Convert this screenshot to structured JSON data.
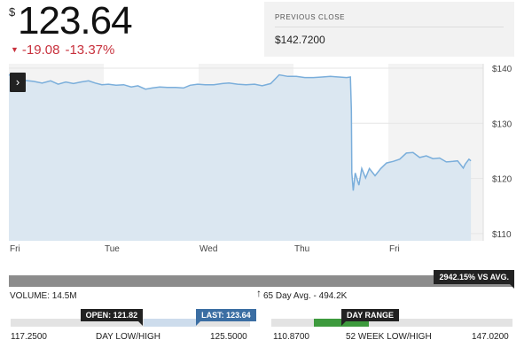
{
  "quote": {
    "currency_symbol": "$",
    "price": "123.64",
    "change": "-19.08",
    "change_percent": "-13.37%",
    "change_color": "#c8313d"
  },
  "previous_close": {
    "label": "PREVIOUS CLOSE",
    "value": "$142.7200"
  },
  "chart_toggle_label": "›",
  "chart_data": {
    "type": "area",
    "x_tick_labels": [
      "Fri",
      "Tue",
      "Wed",
      "Thu",
      "Fri"
    ],
    "y_tick_labels": [
      "$140",
      "$130",
      "$120",
      "$110"
    ],
    "y_ticks": [
      140,
      130,
      120,
      110
    ],
    "ylim": [
      108.7,
      140.8
    ],
    "grid": true,
    "line_color": "#7aaedb",
    "fill_color": "#dbe7f1",
    "series": [
      {
        "points": [
          [
            0,
            138.8
          ],
          [
            0.3,
            138.6
          ],
          [
            1.0,
            138.0
          ],
          [
            1.6,
            137.8
          ],
          [
            2.6,
            137.6
          ],
          [
            3.5,
            137.3
          ],
          [
            4.4,
            137.7
          ],
          [
            5.2,
            137.1
          ],
          [
            6.0,
            137.5
          ],
          [
            6.8,
            137.2
          ],
          [
            7.6,
            137.5
          ],
          [
            8.4,
            137.7
          ],
          [
            9.1,
            137.3
          ],
          [
            9.8,
            137.0
          ],
          [
            10.5,
            137.1
          ],
          [
            11.3,
            136.9
          ],
          [
            12.1,
            137.0
          ],
          [
            12.9,
            136.6
          ],
          [
            13.6,
            136.8
          ],
          [
            14.4,
            136.2
          ],
          [
            15.1,
            136.4
          ],
          [
            15.9,
            136.6
          ],
          [
            16.7,
            136.5
          ],
          [
            17.6,
            136.5
          ],
          [
            18.4,
            136.4
          ],
          [
            19.1,
            136.9
          ],
          [
            19.9,
            137.1
          ],
          [
            20.7,
            137.0
          ],
          [
            21.6,
            137.0
          ],
          [
            22.5,
            137.2
          ],
          [
            23.2,
            137.3
          ],
          [
            24.1,
            137.1
          ],
          [
            25.0,
            137.0
          ],
          [
            25.9,
            137.1
          ],
          [
            26.7,
            136.8
          ],
          [
            27.6,
            137.2
          ],
          [
            28.5,
            138.8
          ],
          [
            29.4,
            138.5
          ],
          [
            30.3,
            138.5
          ],
          [
            31.2,
            138.3
          ],
          [
            32.1,
            138.3
          ],
          [
            33.0,
            138.4
          ],
          [
            33.9,
            138.5
          ],
          [
            34.8,
            138.4
          ],
          [
            35.6,
            138.3
          ],
          [
            36.0,
            138.4
          ],
          [
            36.1,
            132.4
          ],
          [
            36.15,
            121.0
          ],
          [
            36.3,
            117.8
          ],
          [
            36.5,
            121.0
          ],
          [
            36.9,
            118.8
          ],
          [
            37.2,
            121.8
          ],
          [
            37.6,
            120.1
          ],
          [
            38.0,
            121.8
          ],
          [
            38.6,
            120.5
          ],
          [
            39.2,
            121.8
          ],
          [
            39.8,
            122.8
          ],
          [
            40.5,
            123.1
          ],
          [
            41.2,
            123.5
          ],
          [
            41.9,
            124.6
          ],
          [
            42.6,
            124.7
          ],
          [
            43.3,
            123.8
          ],
          [
            44.0,
            124.1
          ],
          [
            44.7,
            123.6
          ],
          [
            45.4,
            123.7
          ],
          [
            46.1,
            123.0
          ],
          [
            46.8,
            123.1
          ],
          [
            47.3,
            123.2
          ],
          [
            47.9,
            121.9
          ],
          [
            48.1,
            122.6
          ],
          [
            48.5,
            123.5
          ],
          [
            48.7,
            123.2
          ]
        ]
      }
    ]
  },
  "volume": {
    "label": "VOLUME: 14.5M",
    "vs_avg": "2942.15% VS AVG.",
    "avg_label": "65 Day Avg. - 494.2K",
    "avg_marker": "↑"
  },
  "day_range": {
    "low": "117.2500",
    "high": "125.5000",
    "label": "DAY LOW/HIGH",
    "open_label": "OPEN: 121.82",
    "last_label": "LAST: 123.64",
    "open": 121.82,
    "last": 123.64,
    "low_value": 117.25,
    "high_value": 125.5,
    "fill_color": "#cddcec"
  },
  "week52": {
    "low": "110.8700",
    "high": "147.0200",
    "label": "52 WEEK LOW/HIGH",
    "tag_label": "DAY RANGE",
    "low_value": 110.87,
    "high_value": 147.02,
    "range_low": 117.25,
    "range_high": 125.5,
    "fill_color": "#3d9a3d"
  }
}
